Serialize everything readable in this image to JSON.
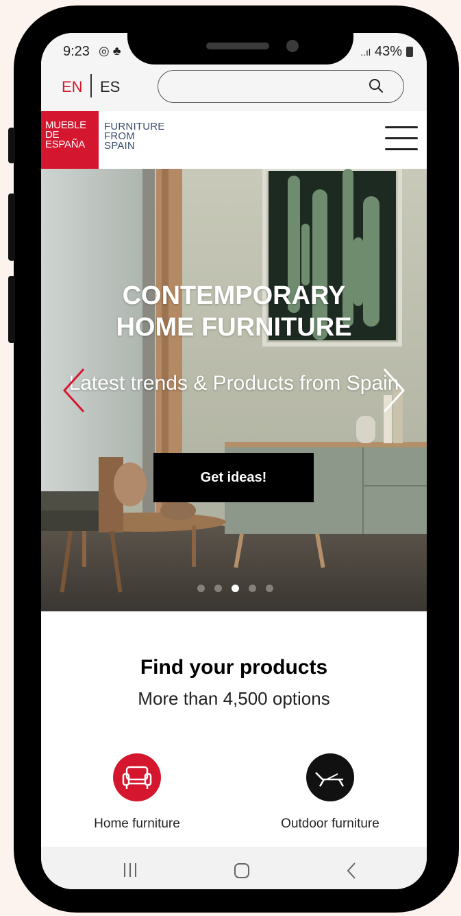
{
  "status_bar": {
    "time": "9:23",
    "left_icons": "◎ ♣",
    "signal": "..ıl",
    "battery": "43%"
  },
  "language": {
    "en": "EN",
    "es": "ES",
    "active": "EN"
  },
  "search": {
    "placeholder": ""
  },
  "logo": {
    "red_lines": [
      "MUEBLE",
      "DE",
      "ESPAÑA"
    ],
    "text_lines": [
      "FURNITURE",
      "FROM",
      "SPAIN"
    ]
  },
  "hero": {
    "title_line1": "CONTEMPORARY",
    "title_line2": "HOME FURNITURE",
    "subtitle": "Latest trends & Products from Spain",
    "button": "Get ideas!",
    "slides_total": 5,
    "slide_active": 3
  },
  "find": {
    "title": "Find your products",
    "subtitle": "More than 4,500 options"
  },
  "categories": [
    {
      "label": "Home furniture",
      "icon": "armchair-icon",
      "color": "#d4172f"
    },
    {
      "label": "Outdoor furniture",
      "icon": "sun-lounger-icon",
      "color": "#111111"
    }
  ],
  "colors": {
    "brand_red": "#d4172f",
    "logo_blue": "#3a4d6e",
    "background": "#fdf3ee"
  }
}
